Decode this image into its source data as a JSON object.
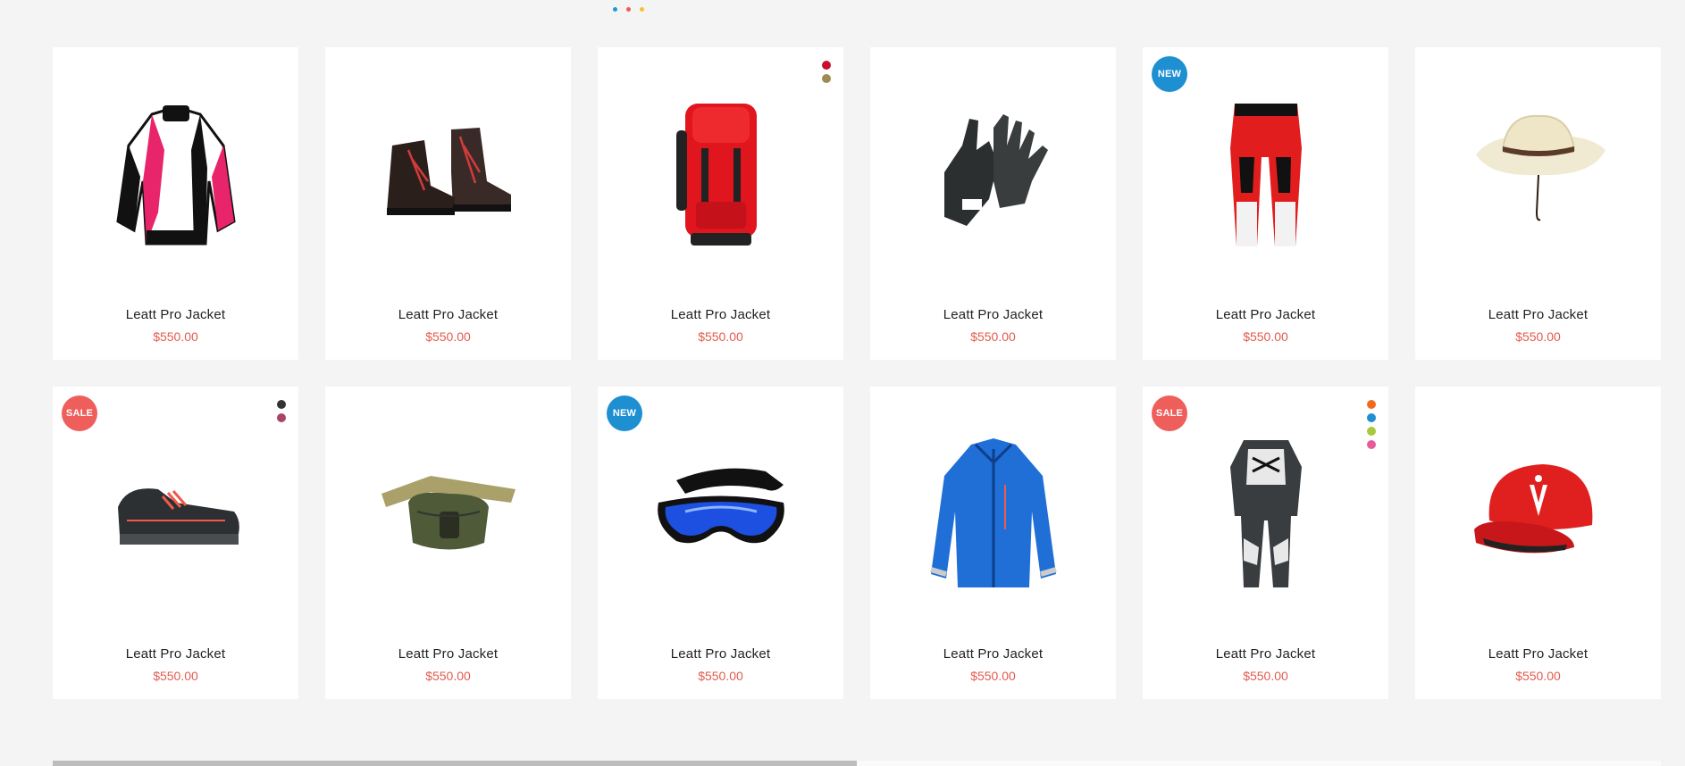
{
  "pagination_dots": [
    {
      "color": "#1e9bd6"
    },
    {
      "color": "#ef5b5b"
    },
    {
      "color": "#f2c431"
    }
  ],
  "products": [
    {
      "title": "Leatt Pro Jacket",
      "price": "$550.00",
      "image": "motocross-jacket",
      "badge": null,
      "swatches": []
    },
    {
      "title": "Leatt Pro Jacket",
      "price": "$550.00",
      "image": "leather-boots",
      "badge": null,
      "swatches": []
    },
    {
      "title": "Leatt Pro Jacket",
      "price": "$550.00",
      "image": "red-backpack",
      "badge": null,
      "swatches": [
        "#c8102e",
        "#9c8b52"
      ]
    },
    {
      "title": "Leatt Pro Jacket",
      "price": "$550.00",
      "image": "black-gloves",
      "badge": null,
      "swatches": []
    },
    {
      "title": "Leatt Pro Jacket",
      "price": "$550.00",
      "image": "red-moto-pants",
      "badge": {
        "text": "NEW",
        "color": "#1e8fd1"
      },
      "swatches": []
    },
    {
      "title": "Leatt Pro Jacket",
      "price": "$550.00",
      "image": "straw-cowboy-hat",
      "badge": null,
      "swatches": []
    },
    {
      "title": "Leatt Pro Jacket",
      "price": "$550.00",
      "image": "black-sneakers",
      "badge": {
        "text": "SALE",
        "color": "#ee5e5b"
      },
      "swatches": [
        "#333333",
        "#a8436a"
      ]
    },
    {
      "title": "Leatt Pro Jacket",
      "price": "$550.00",
      "image": "waist-pack",
      "badge": null,
      "swatches": []
    },
    {
      "title": "Leatt Pro Jacket",
      "price": "$550.00",
      "image": "ski-goggles",
      "badge": {
        "text": "NEW",
        "color": "#1e8fd1"
      },
      "swatches": []
    },
    {
      "title": "Leatt Pro Jacket",
      "price": "$550.00",
      "image": "blue-jacket",
      "badge": null,
      "swatches": []
    },
    {
      "title": "Leatt Pro Jacket",
      "price": "$550.00",
      "image": "moto-suit",
      "badge": {
        "text": "SALE",
        "color": "#ee5e5b"
      },
      "swatches": [
        "#f06a1e",
        "#1e8fd1",
        "#a9c83a",
        "#e85a9c"
      ]
    },
    {
      "title": "Leatt Pro Jacket",
      "price": "$550.00",
      "image": "red-baseball-cap",
      "badge": null,
      "swatches": []
    }
  ],
  "scrollbar": {
    "position": 0.5
  }
}
